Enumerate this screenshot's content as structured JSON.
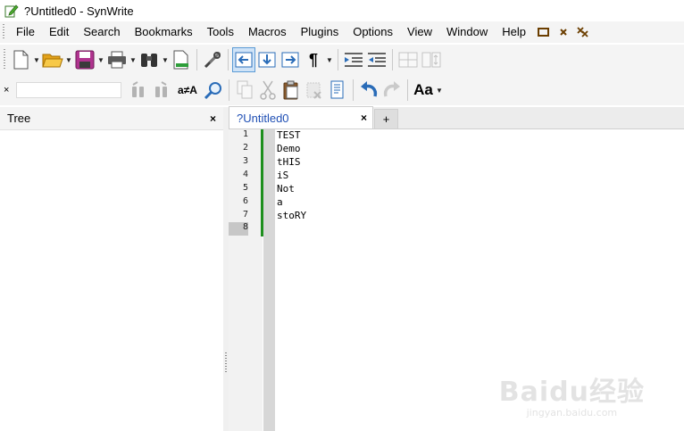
{
  "window": {
    "title": "?Untitled0 - SynWrite",
    "icon": "pencil-note-icon"
  },
  "menu": {
    "items": [
      "File",
      "Edit",
      "Search",
      "Bookmarks",
      "Tools",
      "Macros",
      "Plugins",
      "Options",
      "View",
      "Window",
      "Help"
    ],
    "restore_icon": "restore-window-icon",
    "close_icon": "close-x-icon",
    "extra_icon": "close-all-icon"
  },
  "toolbar1": {
    "buttons": [
      "new-file-icon",
      "open-folder-icon",
      "save-disk-icon",
      "print-icon",
      "find-binoculars-icon",
      "export-icon",
      "settings-tools-icon",
      "go-back-icon",
      "go-down-icon",
      "go-forward-icon",
      "pilcrow-icon",
      "indent-icon",
      "unindent-icon",
      "toggle-panel-icon",
      "sync-scroll-icon"
    ]
  },
  "toolbar2": {
    "search_close": "×",
    "search_placeholder": "",
    "case_button": "a≠A",
    "font_button": "Aa",
    "buttons": [
      "find-prev-icon",
      "find-next-icon",
      "case-sensitive-icon",
      "zoom-find-icon",
      "copy-icon",
      "cut-icon",
      "paste-icon",
      "delete-icon",
      "clipboard-icon",
      "undo-icon",
      "redo-icon",
      "font-size-icon"
    ]
  },
  "tree_panel": {
    "title": "Tree",
    "close": "×"
  },
  "tabs": [
    {
      "label": "?Untitled0",
      "close": "×"
    }
  ],
  "add_tab": "+",
  "editor": {
    "lines": [
      "TEST",
      "Demo",
      "tHIS",
      "iS",
      "Not",
      "a",
      "stoRY",
      ""
    ],
    "line_numbers": [
      "1",
      "2",
      "3",
      "4",
      "5",
      "6",
      "7",
      "8"
    ],
    "current_line": "8",
    "change_bar_color": "#1e8f1e"
  },
  "watermark": {
    "main": "Baidu经验",
    "sub": "jingyan.baidu.com"
  }
}
